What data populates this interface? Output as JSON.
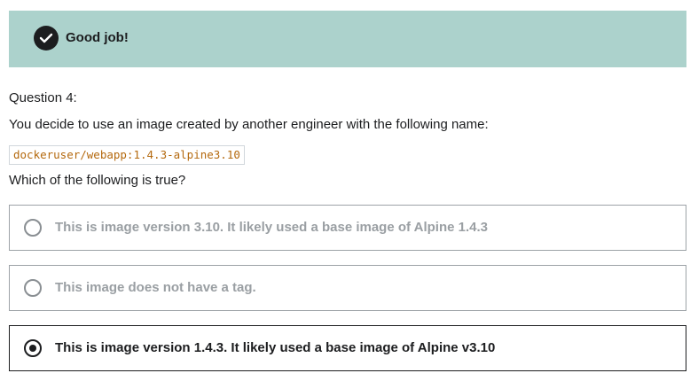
{
  "feedback": {
    "message": "Good job!",
    "icon": "check-circle-icon"
  },
  "question": {
    "label": "Question 4:",
    "text": "You decide to use an image created by another engineer with the following name:",
    "code": "dockeruser/webapp:1.4.3-alpine3.10",
    "prompt": "Which of the following is true?"
  },
  "options": [
    {
      "label": "This is image version 3.10. It likely used a base image of Alpine 1.4.3",
      "selected": false
    },
    {
      "label": "This image does not have a tag.",
      "selected": false
    },
    {
      "label": "This is image version 1.4.3. It likely used a base image of Alpine v3.10",
      "selected": true
    }
  ],
  "colors": {
    "banner_bg": "#acd2cc",
    "code_text": "#b4690e",
    "text_dark": "#1c1d1f",
    "text_muted": "#9a9fa3"
  }
}
